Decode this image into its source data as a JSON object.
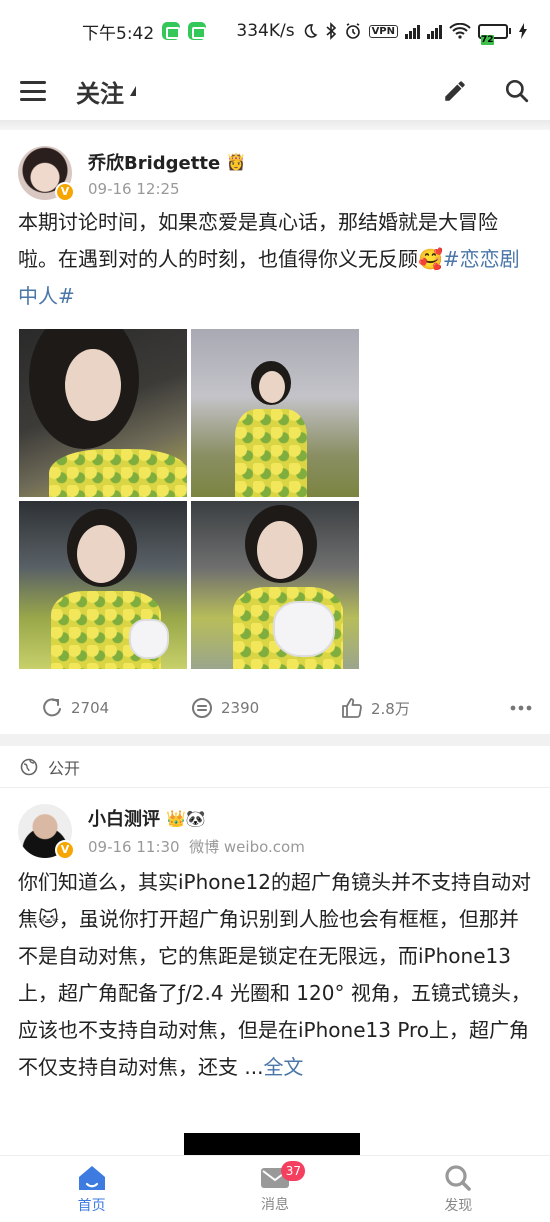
{
  "status_bar": {
    "time": "下午5:42",
    "net_speed": "334K/s",
    "battery": "72"
  },
  "header": {
    "title": "关注"
  },
  "posts": [
    {
      "user": "乔欣Bridgette",
      "user_emoji": "👸",
      "time": "09-16 12:25",
      "source": "",
      "text": "本期讨论时间，如果恋爱是真心话，那结婚就是大冒险啦。在遇到对的人的时刻，也值得你义无反顾🥰",
      "hashtag": "#恋恋剧中人#",
      "stats": {
        "reposts": "2704",
        "comments": "2390",
        "likes": "2.8万"
      }
    },
    {
      "visibility": "公开",
      "user": "小白测评",
      "user_emoji": "👑🐼",
      "time": "09-16 11:30",
      "source": "微博 weibo.com",
      "text": "你们知道么，其实iPhone12的超广角镜头并不支持自动对焦🐱，虽说你打开超广角识别到人脸也会有框框，但那并不是自动对焦，它的焦距是锁定在无限远，而iPhone13 上，超广角配备了ƒ/2.4 光圈和 120° 视角，五镜式镜头，应该也不支持自动对焦，但是在iPhone13 Pro上，超广角不仅支持自动对焦，还支 ...",
      "more_label": "全文"
    }
  ],
  "tabbar": {
    "items": [
      {
        "label": "首页",
        "icon": "home-icon"
      },
      {
        "label": "消息",
        "icon": "mail-icon",
        "badge": "37"
      },
      {
        "label": "发现",
        "icon": "search-icon"
      }
    ]
  },
  "colors": {
    "accent": "#3d7be0",
    "link": "#4a76a8",
    "badge": "#f43f5e"
  }
}
